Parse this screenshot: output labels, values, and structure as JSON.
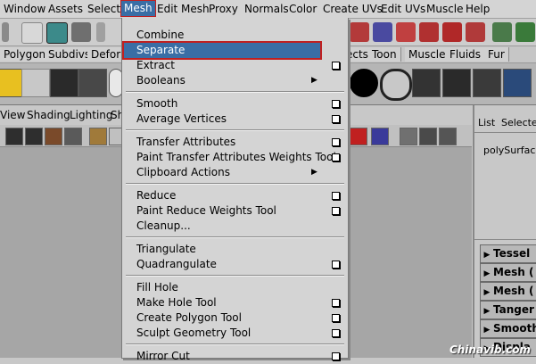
{
  "menubar": {
    "items": [
      "Window",
      "Assets",
      "Select",
      "Mesh",
      "Edit Mesh",
      "Proxy",
      "Normals",
      "Color",
      "Create UVs",
      "Edit UVs",
      "Muscle",
      "Help"
    ],
    "active_index": 3
  },
  "shelf_tabs": [
    "Polygons",
    "Subdivs",
    "Deform",
    "ects",
    "Toon",
    "Muscle",
    "Fluids",
    "Fur"
  ],
  "panel_menu": [
    "View",
    "Shading",
    "Lighting",
    "Sh"
  ],
  "right_panel": {
    "header_list": "List",
    "header_selected": "Selected",
    "node_name": "polySurfaceS",
    "rows": [
      "Tessel",
      "Mesh (",
      "Mesh (",
      "Tanger",
      "Smooth",
      "Displa"
    ]
  },
  "mesh_menu": {
    "groups": [
      [
        {
          "label": "Combine",
          "option": false,
          "submenu": false
        },
        {
          "label": "Separate",
          "option": false,
          "submenu": false,
          "selected": true
        },
        {
          "label": "Extract",
          "option": true,
          "submenu": false
        },
        {
          "label": "Booleans",
          "option": false,
          "submenu": true
        }
      ],
      [
        {
          "label": "Smooth",
          "option": true,
          "submenu": false
        },
        {
          "label": "Average Vertices",
          "option": true,
          "submenu": false
        }
      ],
      [
        {
          "label": "Transfer Attributes",
          "option": true,
          "submenu": false
        },
        {
          "label": "Paint Transfer Attributes Weights Tool",
          "option": true,
          "submenu": false
        },
        {
          "label": "Clipboard Actions",
          "option": false,
          "submenu": true
        }
      ],
      [
        {
          "label": "Reduce",
          "option": true,
          "submenu": false
        },
        {
          "label": "Paint Reduce Weights Tool",
          "option": true,
          "submenu": false
        },
        {
          "label": "Cleanup...",
          "option": false,
          "submenu": false
        }
      ],
      [
        {
          "label": "Triangulate",
          "option": false,
          "submenu": false
        },
        {
          "label": "Quadrangulate",
          "option": true,
          "submenu": false
        }
      ],
      [
        {
          "label": "Fill Hole",
          "option": false,
          "submenu": false
        },
        {
          "label": "Make Hole Tool",
          "option": true,
          "submenu": false
        },
        {
          "label": "Create Polygon Tool",
          "option": true,
          "submenu": false
        },
        {
          "label": "Sculpt Geometry Tool",
          "option": true,
          "submenu": false
        }
      ],
      [
        {
          "label": "Mirror Cut",
          "option": true,
          "submenu": false
        }
      ]
    ]
  },
  "watermark": "Chinavib.com",
  "colors": {
    "selection": "#3a6ea5",
    "highlight_border": "#c02020",
    "menu_bg": "#d4d4d4"
  }
}
